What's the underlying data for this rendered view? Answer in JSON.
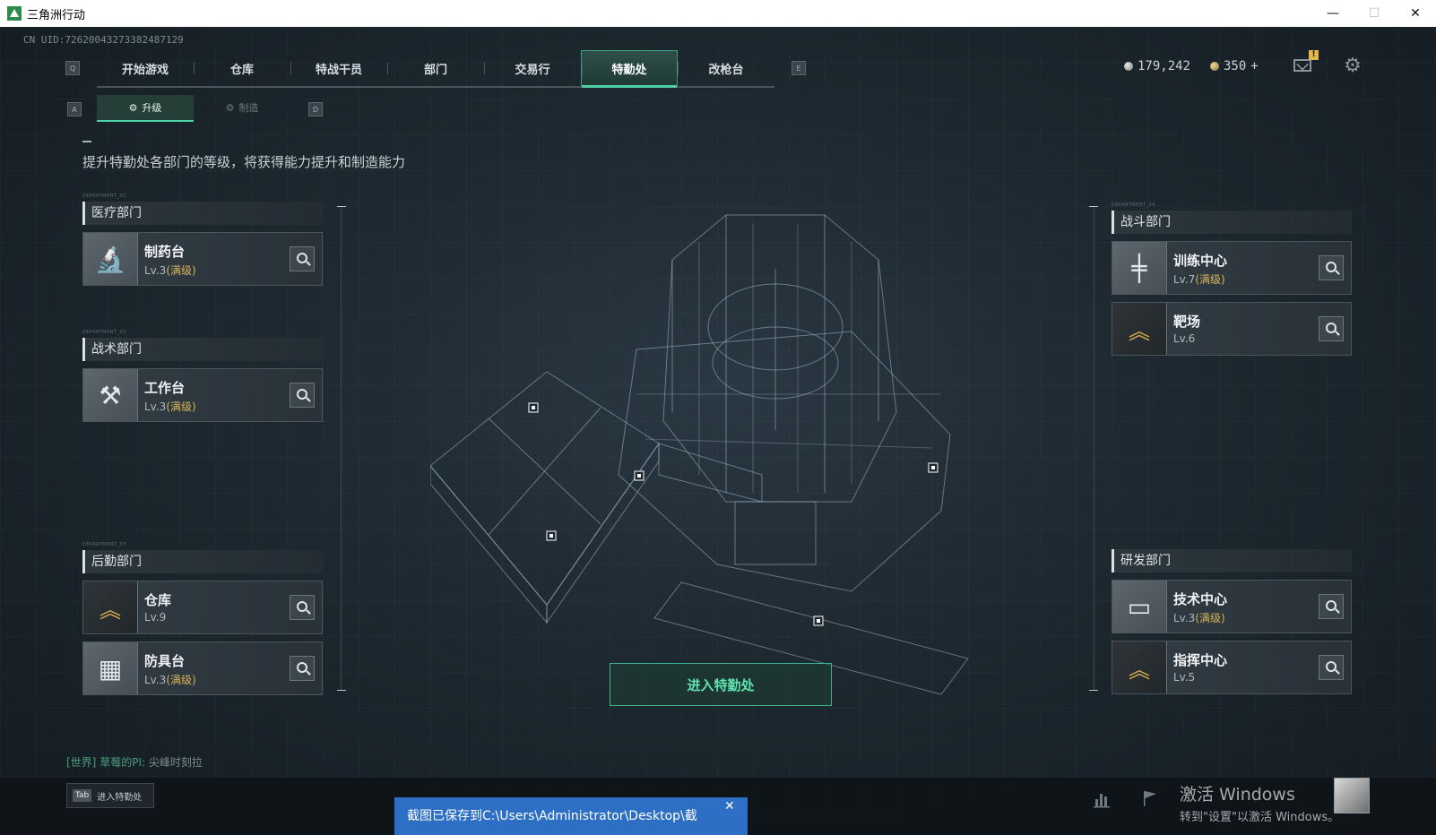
{
  "window": {
    "title": "三角洲行动",
    "minimize": "—",
    "maximize": "☐",
    "close": "✕"
  },
  "uid": "CN UID:7262004327338248712​9",
  "nav": {
    "key_left": "Q",
    "key_right": "E",
    "tabs": [
      "开始游戏",
      "仓库",
      "特战干员",
      "部门",
      "交易行",
      "特勤处",
      "改枪台"
    ],
    "active_tab": "特勤处"
  },
  "subnav": {
    "key_left": "A",
    "key_right": "D",
    "upgrade": "升级",
    "craft": "制造"
  },
  "currency": {
    "silver": "179,242",
    "gold": "350",
    "gold_add": "+"
  },
  "mail_badge": "!",
  "description": "提升特勤处各部门的等级，将获得能力提升和制造能力",
  "departments": {
    "medical": {
      "tag": "DEPARTMENT_01",
      "name": "医疗部门",
      "items": [
        {
          "name": "制药台",
          "level": "Lv.3",
          "max": "(满级)",
          "icon": "microscope-icon"
        }
      ]
    },
    "tactical": {
      "tag": "DEPARTMENT_02",
      "name": "战术部门",
      "items": [
        {
          "name": "工作台",
          "level": "Lv.3",
          "max": "(满级)",
          "icon": "tools-icon"
        }
      ]
    },
    "logistics": {
      "tag": "DEPARTMENT_03",
      "name": "后勤部门",
      "items": [
        {
          "name": "仓库",
          "level": "Lv.9",
          "max": "",
          "icon": "chevron-rank-icon"
        },
        {
          "name": "防具台",
          "level": "Lv.3",
          "max": "(满级)",
          "icon": "cubes-icon"
        }
      ]
    },
    "combat": {
      "tag": "DEPARTMENT_04",
      "name": "战斗部门",
      "items": [
        {
          "name": "训练中心",
          "level": "Lv.7",
          "max": "(满级)",
          "icon": "dumbbell-icon"
        },
        {
          "name": "靶场",
          "level": "Lv.6",
          "max": "",
          "icon": "chevron-rank-icon"
        }
      ]
    },
    "research": {
      "tag": "",
      "name": "研发部门",
      "items": [
        {
          "name": "技术中心",
          "level": "Lv.3",
          "max": "(满级)",
          "icon": "terminal-icon"
        },
        {
          "name": "指挥中心",
          "level": "Lv.5",
          "max": "",
          "icon": "chevron-rank-icon"
        }
      ]
    }
  },
  "enter_button": "进入特勤处",
  "chat": {
    "channel": "[世界]",
    "sender": "草莓的PI:",
    "message": "尖峰时刻拉"
  },
  "tab_hint": {
    "key": "Tab",
    "label": "进入特勤处"
  },
  "toast": {
    "text": "截图已保存到C:\\Users\\Administrator\\Desktop\\截",
    "close": "✕"
  },
  "activate": {
    "line1": "激活 Windows",
    "line2": "转到\"设置\"以激活 Windows。"
  },
  "colors": {
    "accent": "#4fd1a5",
    "max_level": "#d8b35a",
    "toast": "#2d6fc4"
  }
}
